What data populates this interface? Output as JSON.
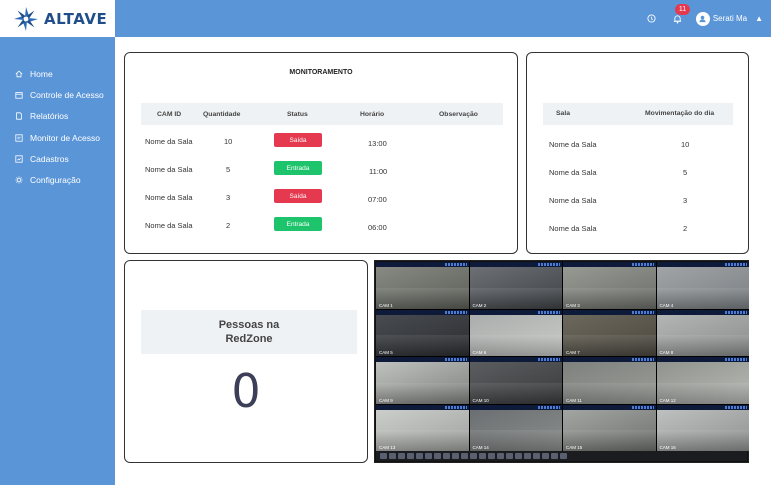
{
  "brand": {
    "name": "ALTAVE"
  },
  "topbar": {
    "notifications_count": "11",
    "user_name": "Serati Ma"
  },
  "sidebar": {
    "items": [
      {
        "label": "Home",
        "icon": "home-icon"
      },
      {
        "label": "Controle de Acesso",
        "icon": "calendar-icon"
      },
      {
        "label": "Relatórios",
        "icon": "document-icon"
      },
      {
        "label": "Monitor de Acesso",
        "icon": "monitor-icon"
      },
      {
        "label": "Cadastros",
        "icon": "register-icon"
      },
      {
        "label": "Configuração",
        "icon": "gear-icon"
      }
    ]
  },
  "monitoramento": {
    "title": "MONITORAMENTO",
    "columns": [
      "CAM ID",
      "Quantidade",
      "Status",
      "Horário",
      "Observação"
    ],
    "rows": [
      {
        "cam_id": "Nome da Sala",
        "quantidade": "10",
        "status": "Saída",
        "horario": "13:00",
        "observacao": ""
      },
      {
        "cam_id": "Nome da Sala",
        "quantidade": "5",
        "status": "Entrada",
        "horario": "11:00",
        "observacao": ""
      },
      {
        "cam_id": "Nome da Sala",
        "quantidade": "3",
        "status": "Saída",
        "horario": "07:00",
        "observacao": ""
      },
      {
        "cam_id": "Nome da Sala",
        "quantidade": "2",
        "status": "Entrada",
        "horario": "06:00",
        "observacao": ""
      }
    ]
  },
  "movimentacao": {
    "columns": [
      "Sala",
      "Movimentação do dia"
    ],
    "rows": [
      {
        "sala": "Nome da Sala",
        "valor": "10"
      },
      {
        "sala": "Nome da Sala",
        "valor": "5"
      },
      {
        "sala": "Nome da Sala",
        "valor": "3"
      },
      {
        "sala": "Nome da Sala",
        "valor": "2"
      }
    ]
  },
  "redzone": {
    "title_line1": "Pessoas na",
    "title_line2": "RedZone",
    "count": "0"
  },
  "cameras": {
    "labels": [
      "CAM 1",
      "CAM 2",
      "CAM 3",
      "CAM 4",
      "CAM 5",
      "CAM 6",
      "CAM 7",
      "CAM 8",
      "CAM 9",
      "CAM 10",
      "CAM 11",
      "CAM 12",
      "CAM 13",
      "CAM 14",
      "CAM 15",
      "CAM 16"
    ]
  },
  "colors": {
    "primary": "#5a95d8",
    "saida": "#e53950",
    "entrada": "#1ec46b"
  }
}
